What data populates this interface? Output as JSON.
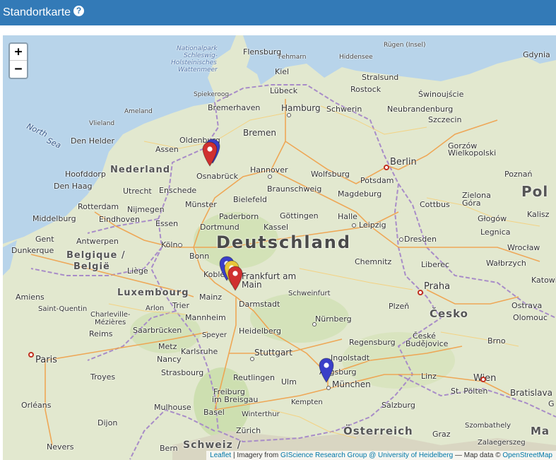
{
  "header": {
    "title": "Standortkarte",
    "help_icon": "?"
  },
  "map": {
    "zoom_in": "+",
    "zoom_out": "−",
    "attribution": {
      "leaflet": "Leaflet",
      "imagery_prefix": " | Imagery from ",
      "provider": "GIScience Research Group @ University of Heidelberg",
      "data_prefix": " — Map data © ",
      "osm": "OpenStreetMap"
    },
    "labels": {
      "deutschland": "Deutschland",
      "nederland": "Nederland",
      "belgique": "Belgique /",
      "belgie": "België",
      "luxembourg": "Luxembourg",
      "cesko": "Česko",
      "osterreich": "Österreich",
      "schweiz": "Schweiz /",
      "pol": "Pol",
      "ma": "Ma",
      "north_sea_1": "North",
      "north_sea_2": "Sea",
      "nationalpark": "Nationalpark",
      "schleswig": "Schleswig-",
      "holstein": "Holsteinisches",
      "wattenmeer": "Wattenmeer",
      "flensburg": "Flensburg",
      "fehmarn": "Fehmarn",
      "hiddensee": "Hiddensee",
      "rugen": "Rügen (Insel)",
      "gdynia": "Gdynia",
      "kiel": "Kiel",
      "stralsund": "Stralsund",
      "lubeck": "Lübeck",
      "rostock": "Rostock",
      "swinoujscie": "Świnoujście",
      "spiekeroog": "Spiekeroog",
      "bremerhaven": "Bremerhaven",
      "hamburg": "Hamburg",
      "schwerin": "Schwerin",
      "neubrandenburg": "Neubrandenburg",
      "ameland": "Ameland",
      "vlieland": "Vlieland",
      "szczecin": "Szczecin",
      "oldenburg": "Oldenburg",
      "bremen": "Bremen",
      "den_helder": "Den Helder",
      "assen": "Assen",
      "gorzow": "Gorzów",
      "wielkopolski": "Wielkopolski",
      "hoofddorp": "Hoofddorp",
      "den_haag": "Den Haag",
      "osnabruck": "Osnabrück",
      "hannover": "Hannover",
      "wolfsburg": "Wolfsburg",
      "berlin": "Berlin",
      "poznan": "Poznań",
      "utrecht": "Utrecht",
      "enschede": "Enschede",
      "braunschweig": "Braunschweig",
      "magdeburg": "Magdeburg",
      "potsdam": "Potsdam",
      "rotterdam": "Rotterdam",
      "nijmegen": "Nijmegen",
      "munster": "Münster",
      "bielefeld": "Bielefeld",
      "zielona": "Zielona",
      "gora": "Góra",
      "kalisz": "Kalisz",
      "middelburg": "Middelburg",
      "eindhoven": "Eindhoven",
      "paderborn": "Paderborn",
      "gottingen": "Göttingen",
      "halle": "Halle",
      "cottbus": "Cottbus",
      "glogow": "Głogów",
      "essen": "Essen",
      "dortmund": "Dortmund",
      "kassel": "Kassel",
      "leipzig": "Leipzig",
      "legnica": "Legnica",
      "gent": "Gent",
      "antwerpen": "Antwerpen",
      "koln": "Köln",
      "dresden": "Dresden",
      "dunkerque": "Dunkerque",
      "bonn": "Bonn",
      "wroclaw": "Wrocław",
      "liege": "Liège",
      "koblenz": "Koblenz",
      "frankfurt": "Frankfurt am",
      "main": "Main",
      "chemnitz": "Chemnitz",
      "liberec": "Liberec",
      "walbrzych": "Wałbrzych",
      "katowi": "Katowi",
      "amiens": "Amiens",
      "mainz": "Mainz",
      "darmstadt": "Darmstadt",
      "schweinfurt": "Schweinfurt",
      "praha": "Praha",
      "ostrava": "Ostrava",
      "saint_quentin": "Saint-Quentin",
      "arlon": "Arlon",
      "trier": "Trier",
      "mannheim": "Mannheim",
      "plzen": "Plzeň",
      "olomouc": "Olomouc",
      "charleville": "Charleville-",
      "mezieres": "Mézières",
      "heidelberg": "Heidelberg",
      "nurnberg": "Nürnberg",
      "reims": "Reims",
      "saarbrucken": "Saarbrücken",
      "speyer": "Speyer",
      "regensburg": "Regensburg",
      "ceske": "České",
      "budejovice": "Budějovice",
      "brno": "Brno",
      "metz": "Metz",
      "karlsruhe": "Karlsruhe",
      "stuttgart": "Stuttgart",
      "ingolstadt": "Ingolstadt",
      "paris": "Paris",
      "nancy": "Nancy",
      "augsburg": "Augsburg",
      "troyes": "Troyes",
      "strasbourg": "Strasbourg",
      "reutlingen": "Reutlingen",
      "ulm": "Ulm",
      "munchen": "München",
      "linz": "Linz",
      "wien": "Wien",
      "bratislava": "Bratislava",
      "freiburg": "Freiburg",
      "im_breisgau": "im Breisgau",
      "st_polten": "St. Pölten",
      "orleans": "Orléans",
      "mulhouse": "Mulhouse",
      "kempten": "Kempten",
      "salzburg": "Salzburg",
      "basel": "Basel",
      "winterthur": "Winterthur",
      "dijon": "Dijon",
      "zurich": "Zürich",
      "graz": "Graz",
      "szombathely": "Szombathely",
      "zalaegerszeg": "Zalaegerszeg",
      "nevers": "Nevers",
      "bern": "Bern",
      "gi": "G"
    },
    "markers": [
      {
        "name": "marker-oldenburg-blue",
        "color": "#3a3fc8"
      },
      {
        "name": "marker-oldenburg-red",
        "color": "#d03030"
      },
      {
        "name": "marker-koblenz-blue",
        "color": "#3a3fc8"
      },
      {
        "name": "marker-koblenz-yellow",
        "color": "#e8c63a"
      },
      {
        "name": "marker-frankfurt-red",
        "color": "#d03030"
      },
      {
        "name": "marker-munchen-blue",
        "color": "#3a3fc8"
      }
    ]
  }
}
